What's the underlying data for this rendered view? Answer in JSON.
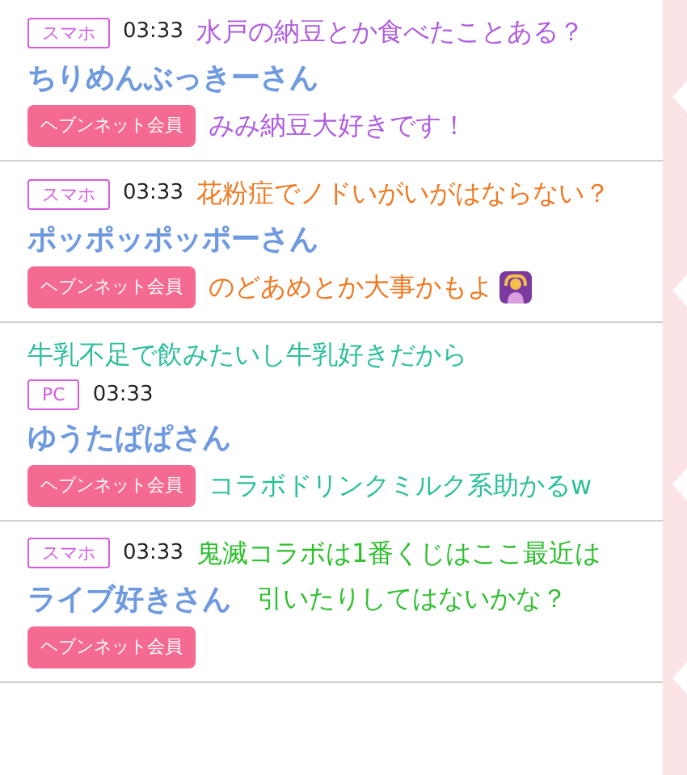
{
  "comments": [
    {
      "device": "スマホ",
      "time": "03:33",
      "name": "ちりめんぶっきーさん",
      "badge": "ヘブンネット会員",
      "overlay": {
        "color": "#b05de0",
        "lines": [
          {
            "kind": "header-row",
            "text": "水戸の納豆とか食べたことある？"
          },
          {
            "kind": "badge-row",
            "text": "みみ納豆大好きです！"
          }
        ]
      }
    },
    {
      "device": "スマホ",
      "time": "03:33",
      "name": "ポッポッポッポーさん",
      "badge": "ヘブンネット会員",
      "overlay": {
        "color": "#f07820",
        "emoji": true,
        "lines": [
          {
            "kind": "header-row",
            "text": "花粉症でノドいがいがはならない？"
          },
          {
            "kind": "badge-row",
            "text": "のどあめとか大事かもよ"
          }
        ]
      }
    },
    {
      "device": "PC",
      "time": "03:33",
      "name": "ゆうたぱぱさん",
      "badge": "ヘブンネット会員",
      "overlay": {
        "color": "#2cbf9c",
        "lines": [
          {
            "kind": "above",
            "text": "牛乳不足で飲みたいし牛乳好きだから"
          },
          {
            "kind": "badge-row",
            "text": "コラボドリンクミルク系助かるw"
          }
        ]
      }
    },
    {
      "device": "スマホ",
      "time": "03:33",
      "name": "ライブ好きさん",
      "badge": "ヘブンネット会員",
      "overlay": {
        "color": "#2fbf2f",
        "lines": [
          {
            "kind": "header-row",
            "text": "鬼滅コラボは1番くじはここ最近は"
          },
          {
            "kind": "name-row",
            "text": "引いたりしてはないかな？"
          }
        ]
      }
    }
  ]
}
